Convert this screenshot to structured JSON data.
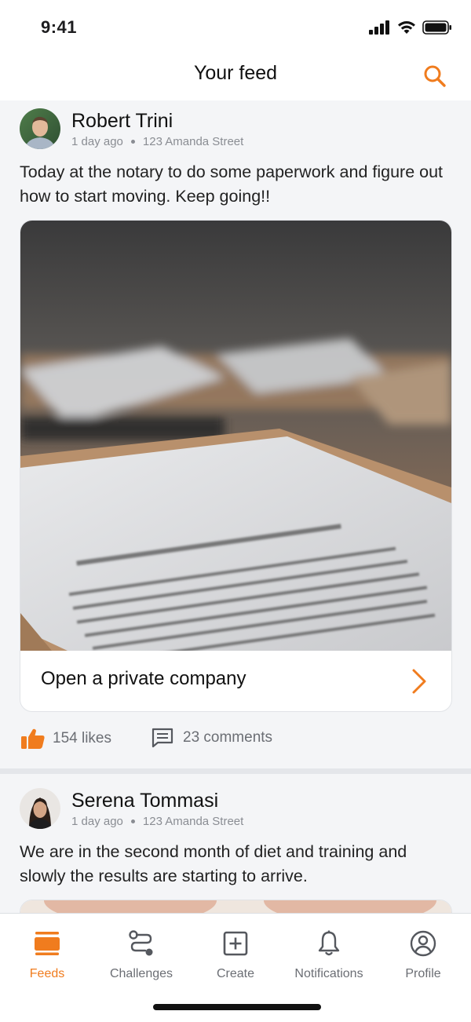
{
  "status_bar": {
    "time": "9:41"
  },
  "header": {
    "title": "Your feed",
    "search_icon": "search-icon"
  },
  "accent_color": "#f07c1e",
  "posts": [
    {
      "author": "Robert Trini",
      "time_ago": "1 day ago",
      "location": "123 Amanda Street",
      "text": "Today at the notary to do some paperwork and figure out how to start moving. Keep going!!",
      "card_title": "Open a private company",
      "likes": "154 likes",
      "comments": "23 comments"
    },
    {
      "author": "Serena Tommasi",
      "time_ago": "1 day ago",
      "location": "123 Amanda Street",
      "text": "We are in the second month of diet and training and slowly the results are starting to arrive."
    }
  ],
  "tabs": [
    {
      "label": "Feeds",
      "icon": "feeds-icon",
      "active": true
    },
    {
      "label": "Challenges",
      "icon": "challenges-icon",
      "active": false
    },
    {
      "label": "Create",
      "icon": "create-icon",
      "active": false
    },
    {
      "label": "Notifications",
      "icon": "bell-icon",
      "active": false
    },
    {
      "label": "Profile",
      "icon": "profile-icon",
      "active": false
    }
  ]
}
